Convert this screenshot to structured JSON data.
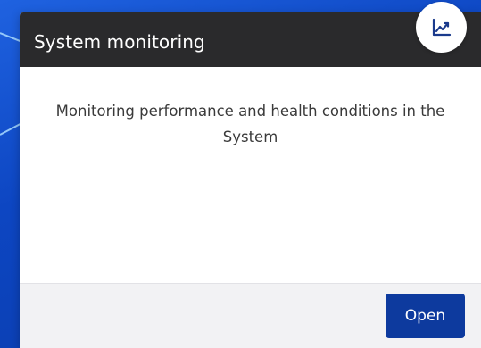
{
  "card": {
    "title": "System monitoring",
    "description": "Monitoring performance and health conditions in the System",
    "open_label": "Open",
    "icon": "trending-chart-icon"
  },
  "colors": {
    "background": "#0d46c2",
    "header": "#2a2a2c",
    "button": "#0d3a9e",
    "footer": "#f2f2f4",
    "icon": "#1a3a8c"
  }
}
